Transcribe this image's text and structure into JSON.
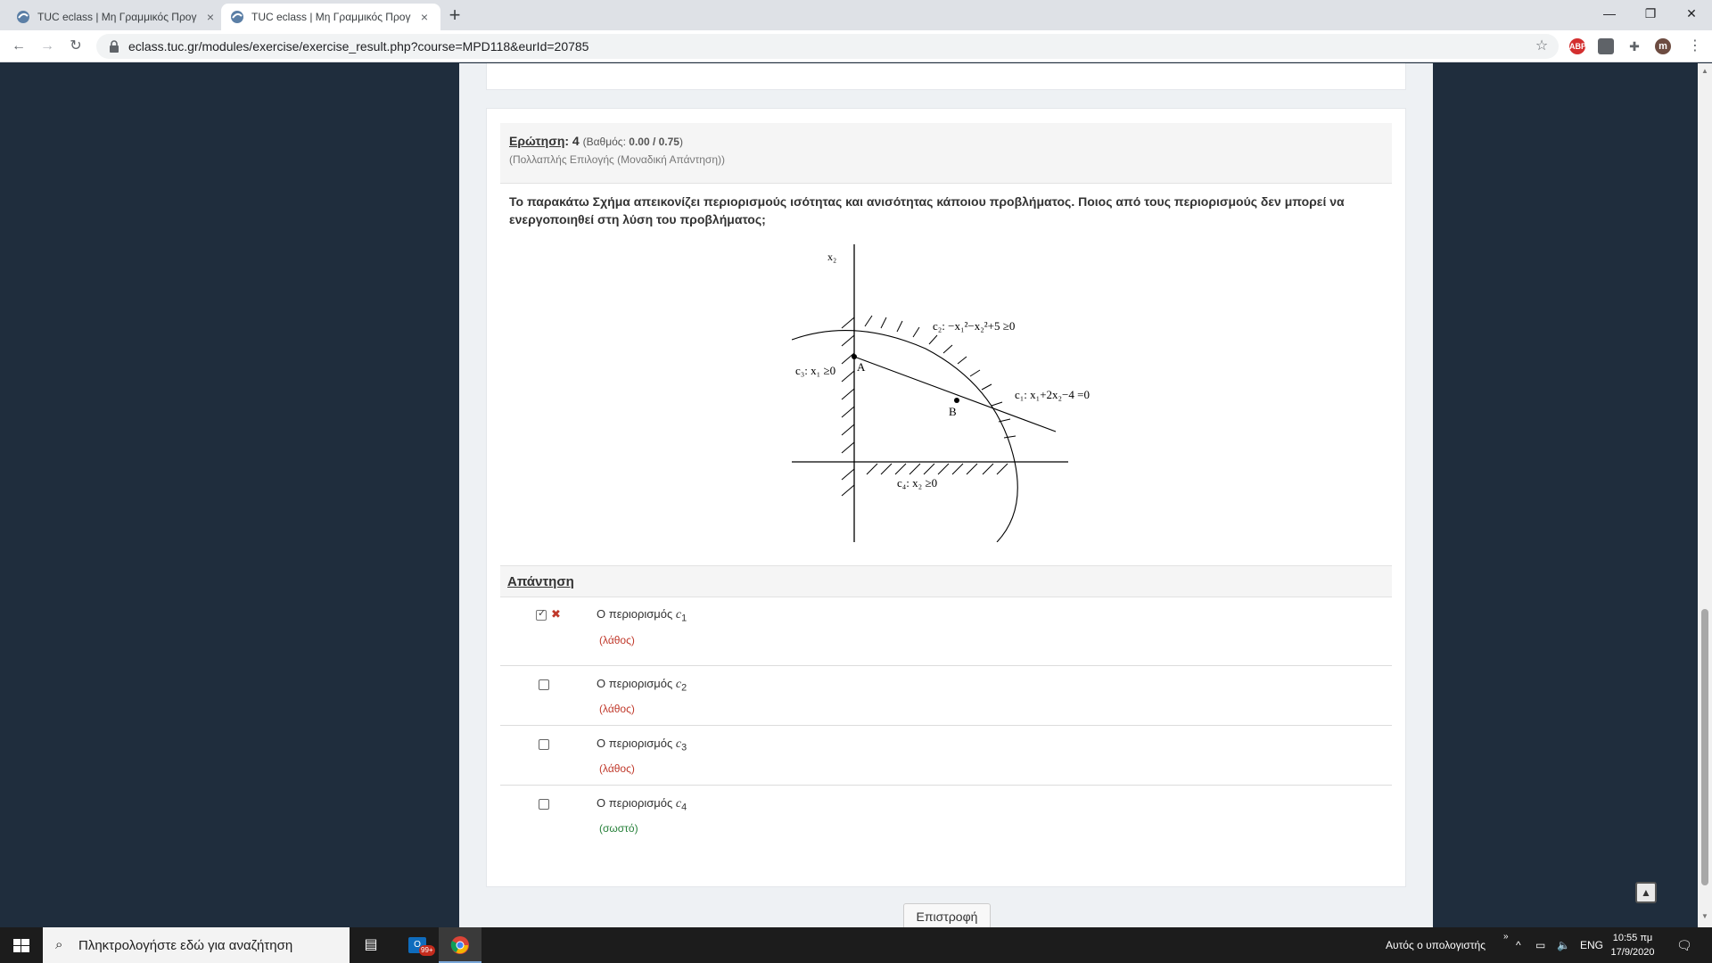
{
  "browser": {
    "tabs": [
      {
        "title": "TUC eclass | Μη Γραμμικός Προγ",
        "close": "×"
      },
      {
        "title": "TUC eclass | Μη Γραμμικός Προγ",
        "close": "×"
      }
    ],
    "new_tab": "+",
    "url": "eclass.tuc.gr/modules/exercise/exercise_result.php?course=MPD118&eurId=20785",
    "profile_initial": "m",
    "extensions": [
      "ABP",
      "pdf",
      "puzzle"
    ]
  },
  "question": {
    "label": "Ερώτηση",
    "number": ": 4",
    "grade_prefix": "(Βαθμός: ",
    "grade_value": "0.00 / 0.75",
    "grade_suffix": ")",
    "type": "(Πολλαπλής Επιλογής (Μοναδική Απάντηση))",
    "text": "Το παρακάτω Σχήμα απεικονίζει περιορισμούς ισότητας και ανισότητας κάποιου προβλήματος. Ποιος από τους περιορισμούς δεν μπορεί να ενεργοποιηθεί στη λύση του προβλήματος;"
  },
  "figure": {
    "x2_label": "x₂",
    "point_a": "A",
    "point_b": "B",
    "c1": "c₁: x₁+2x₂−4 =0",
    "c2": "c₂: −x₁²−x₂²+5 ≥0",
    "c3": "c₃: x₁ ≥0",
    "c4": "c₄: x₂ ≥0"
  },
  "answer": {
    "header": "Απάντηση",
    "prefix": "Ο περιορισμός ",
    "options": [
      {
        "symbol": "c",
        "sub": "1",
        "checked": true,
        "feedback": "(λάθος)",
        "mark": "✖"
      },
      {
        "symbol": "c",
        "sub": "2",
        "checked": false,
        "feedback": "(λάθος)"
      },
      {
        "symbol": "c",
        "sub": "3",
        "checked": false,
        "feedback": "(λάθος)"
      },
      {
        "symbol": "c",
        "sub": "4",
        "checked": false,
        "feedback": "(σωστό)"
      }
    ]
  },
  "back_button": "Επιστροφή",
  "taskbar": {
    "search_placeholder": "Πληκτρολογήστε εδώ για αναζήτηση",
    "tray_text": "Αυτός ο υπολογιστής",
    "lang": "ENG",
    "time": "10:55 πμ",
    "date": "17/9/2020",
    "notif_badge": "99+"
  },
  "colors": {
    "page_background": "#1f2d3d",
    "wrong": "#c0392b",
    "right": "#27803a"
  }
}
